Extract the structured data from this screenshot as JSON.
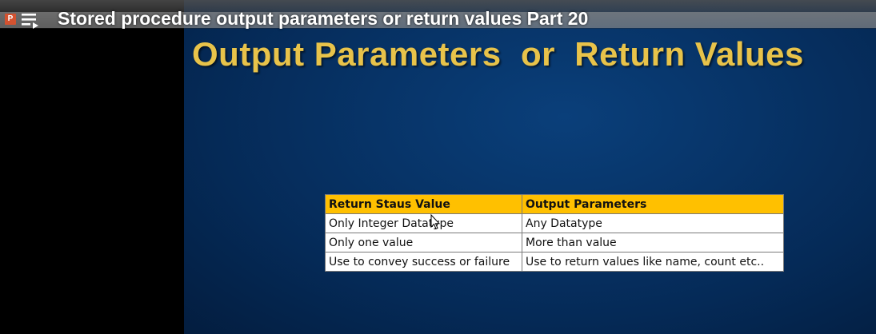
{
  "video": {
    "title": "Stored procedure output parameters or return values Part 20"
  },
  "slide": {
    "title": "Output Parameters  or  Return Values",
    "title_color": "#e8c34a",
    "background_color": "#073468",
    "table": {
      "headers": [
        "Return Staus Value",
        "Output Parameters"
      ],
      "header_color": "#ffc000",
      "rows": [
        [
          "Only Integer Datatype",
          "Any Datatype"
        ],
        [
          "Only one value",
          "More than value"
        ],
        [
          "Use to convey success or failure",
          "Use to return values like name, count etc.."
        ]
      ]
    }
  },
  "icons": {
    "app": "powerpoint-icon",
    "playlist": "playlist-icon",
    "cursor": "mouse-cursor-icon"
  }
}
